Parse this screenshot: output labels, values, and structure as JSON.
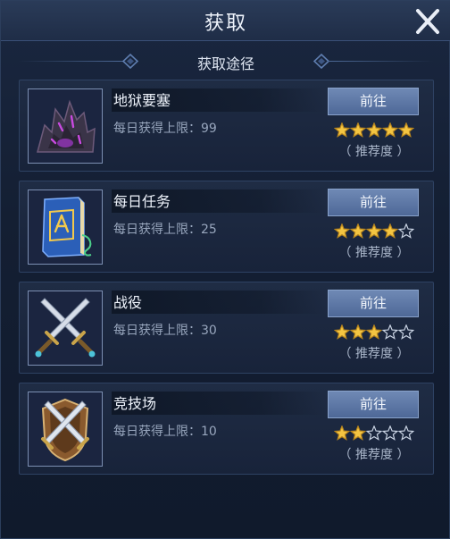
{
  "title": "获取",
  "section_title": "获取途径",
  "go_label": "前往",
  "recommend_label": "（ 推荐度 ）",
  "colors": {
    "star_filled": "#f4c542",
    "star_empty": "#c9d3e3",
    "button": "#5b76a6"
  },
  "items": [
    {
      "name": "地狱要塞",
      "limit": "每日获得上限：99",
      "rating": 5,
      "icon": "demon-fortress-icon"
    },
    {
      "name": "每日任务",
      "limit": "每日获得上限：25",
      "rating": 4,
      "icon": "quest-book-icon"
    },
    {
      "name": "战役",
      "limit": "每日获得上限：30",
      "rating": 3,
      "icon": "crossed-swords-icon"
    },
    {
      "name": "竞技场",
      "limit": "每日获得上限：10",
      "rating": 2,
      "icon": "arena-shield-icon"
    }
  ]
}
